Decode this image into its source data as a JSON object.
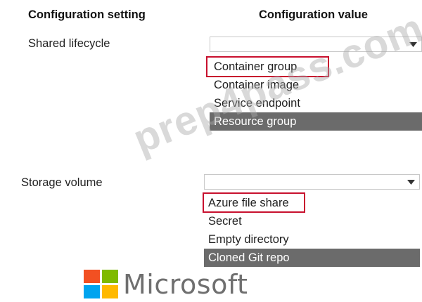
{
  "headers": {
    "setting": "Configuration setting",
    "value": "Configuration value"
  },
  "rows": [
    {
      "label": "Shared lifecycle",
      "selected_value": "",
      "options": [
        "Container group",
        "Container image",
        "Service endpoint",
        "Resource group"
      ],
      "highlighted_option": "Resource group",
      "answer_option": "Container group"
    },
    {
      "label": "Storage volume",
      "selected_value": "",
      "options": [
        "Azure file share",
        "Secret",
        "Empty directory",
        "Cloned Git repo"
      ],
      "highlighted_option": "Cloned Git repo",
      "answer_option": "Azure file share"
    }
  ],
  "watermark": "prep4pass.com",
  "brand": {
    "name": "Microsoft",
    "logo_colors": [
      "#f25022",
      "#7fba00",
      "#00a4ef",
      "#ffb900"
    ]
  },
  "colors": {
    "answer_box": "#c8102e",
    "highlight_bg": "#6b6b6b"
  }
}
